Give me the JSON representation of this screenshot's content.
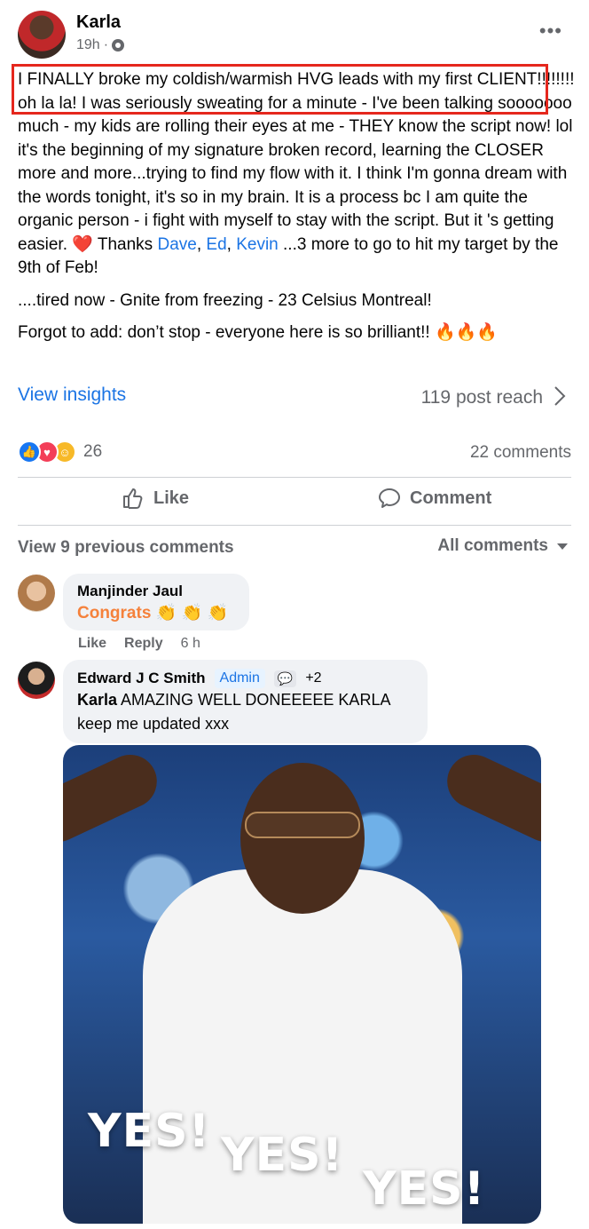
{
  "post": {
    "author": "Karla",
    "time": "19h",
    "separator": "·",
    "text_line1": "I FINALLY broke my coldish/warmish HVG leads with my first CLIENT!!!!!!!! oh la la! I was seriously sweating for a minute - I've been talking sooooooo much - my kids are rolling their eyes at me - THEY know the script now! lol it's the beginning of my signature broken record, learning the CLOSER more and more...trying to find my flow with it.  I think I'm gonna dream with the words tonight, it's so in my brain. It is a process bc I am quite the organic person - i fight with myself to stay with the script. But it 's getting easier.",
    "heart_emoji": "❤️",
    "thanks_prefix": "Thanks",
    "tags": [
      "Dave",
      "Ed",
      "Kevin"
    ],
    "thanks_suffix": "...3 more to go to hit my target by the 9th of Feb!",
    "para2": "....tired now - Gnite from freezing - 23 Celsius Montreal!",
    "para3": "Forgot to add: don’t stop - everyone here is so brilliant!!",
    "fire_emojis": "🔥🔥🔥"
  },
  "insights": {
    "link_label": "View insights",
    "reach": "119 post reach"
  },
  "engagement": {
    "reaction_count": "26",
    "comments_count": "22 comments"
  },
  "actions": {
    "like": "Like",
    "comment": "Comment"
  },
  "comments_header": {
    "view_previous": "View 9 previous comments",
    "filter": "All comments"
  },
  "comments": [
    {
      "name": "Manjinder Jaul",
      "text": "Congrats",
      "emoji": "👏 👏 👏",
      "like": "Like",
      "reply": "Reply",
      "time": "6 h"
    },
    {
      "name": "Edward J C Smith",
      "badge_admin": "Admin",
      "badge_plus": "+2",
      "mention": "Karla",
      "text": "AMAZING WELL DONEEEEE KARLA keep me updated xxx"
    }
  ],
  "gif": {
    "caption_1": "YES!",
    "caption_2": "YES!",
    "caption_3": "YES!"
  },
  "colors": {
    "link_blue": "#1b74e4",
    "highlight_red": "#e5271d",
    "muted_gray": "#65676b",
    "congrats_orange": "#f5813b"
  }
}
